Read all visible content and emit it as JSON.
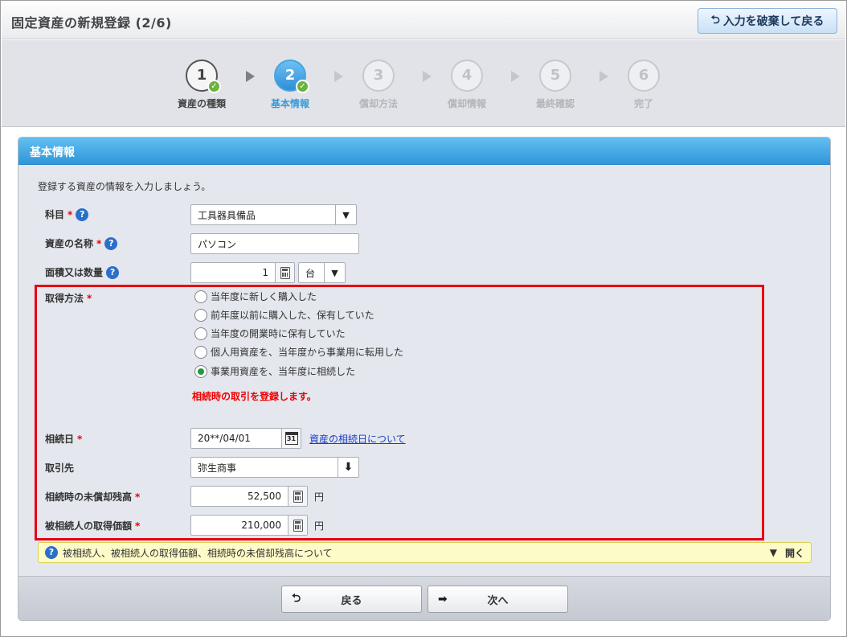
{
  "header": {
    "title": "固定資産の新規登録 (2/6)",
    "discard_button": "入力を破棄して戻る"
  },
  "stepper": {
    "steps": [
      {
        "num": "1",
        "label": "資産の種類",
        "state": "done"
      },
      {
        "num": "2",
        "label": "基本情報",
        "state": "current"
      },
      {
        "num": "3",
        "label": "償却方法",
        "state": "todo"
      },
      {
        "num": "4",
        "label": "償却情報",
        "state": "todo"
      },
      {
        "num": "5",
        "label": "最終確認",
        "state": "todo"
      },
      {
        "num": "6",
        "label": "完了",
        "state": "todo"
      }
    ]
  },
  "panel": {
    "title": "基本情報",
    "intro": "登録する資産の情報を入力しましょう。",
    "required_mark": "*",
    "help_icon": "?",
    "fields": {
      "account": {
        "label": "科目",
        "value": "工具器具備品"
      },
      "asset_name": {
        "label": "資産の名称",
        "value": "パソコン"
      },
      "quantity": {
        "label": "面積又は数量",
        "value": "1",
        "unit_value": "台"
      },
      "acquisition_method": {
        "label": "取得方法",
        "options": [
          "当年度に新しく購入した",
          "前年度以前に購入した、保有していた",
          "当年度の開業時に保有していた",
          "個人用資産を、当年度から事業用に転用した",
          "事業用資産を、当年度に相続した"
        ],
        "selected_index": 4,
        "notice": "相続時の取引を登録します。"
      },
      "inherit_date": {
        "label": "相続日",
        "value": "20**/04/01",
        "link": "資産の相続日について",
        "cal_day": "31"
      },
      "partner": {
        "label": "取引先",
        "value": "弥生商事"
      },
      "unamortized_balance": {
        "label": "相続時の未償却残高",
        "value": "52,500",
        "unit": "円"
      },
      "inheritee_cost": {
        "label": "被相続人の取得価額",
        "value": "210,000",
        "unit": "円"
      }
    },
    "info_bar": {
      "text": "被相続人、被相続人の取得価額、相続時の未償却残高について",
      "toggle_label": "開く"
    },
    "footer": {
      "back_label": "戻る",
      "next_label": "次へ"
    }
  },
  "colors": {
    "accent": "#2e97da",
    "highlight": "#e60012",
    "required": "#ee0000",
    "radio_selected": "#1f9a3c"
  },
  "icons": [
    "return-arrow-icon",
    "check-icon",
    "help-icon",
    "dropdown-arrow-icon",
    "calculator-icon",
    "calendar-icon",
    "download-arrow-icon",
    "right-arrow-icon"
  ]
}
